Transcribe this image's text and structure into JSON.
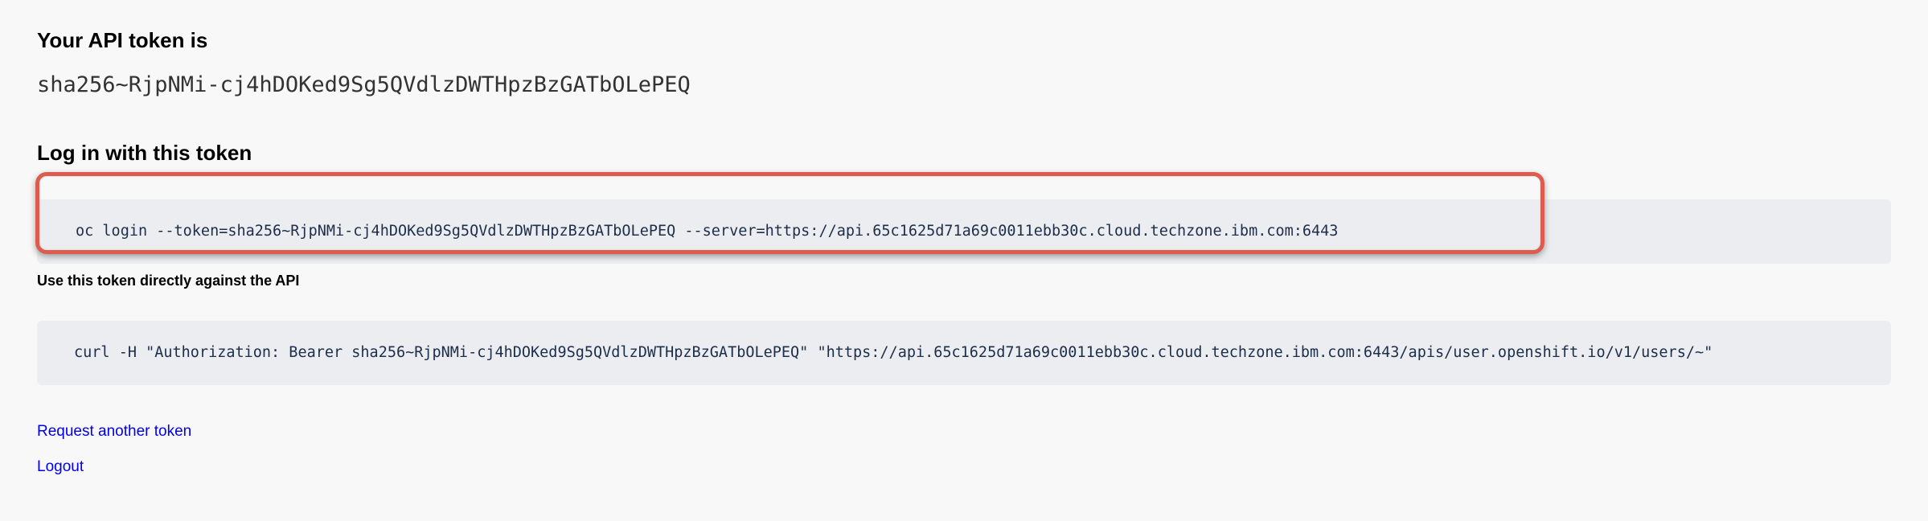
{
  "token_section": {
    "heading": "Your API token is",
    "token": "sha256~RjpNMi-cj4hDOKed9Sg5QVdlzDWTHpzBzGATbOLePEQ"
  },
  "login_section": {
    "heading": "Log in with this token",
    "command": "oc login --token=sha256~RjpNMi-cj4hDOKed9Sg5QVdlzDWTHpzBzGATbOLePEQ --server=https://api.65c1625d71a69c0011ebb30c.cloud.techzone.ibm.com:6443",
    "highlight_color": "#de5b4f"
  },
  "api_section": {
    "heading": "Use this token directly against the API",
    "command": "curl -H \"Authorization: Bearer sha256~RjpNMi-cj4hDOKed9Sg5QVdlzDWTHpzBzGATbOLePEQ\" \"https://api.65c1625d71a69c0011ebb30c.cloud.techzone.ibm.com:6443/apis/user.openshift.io/v1/users/~\""
  },
  "links": {
    "request_another": "Request another token",
    "logout": "Logout",
    "color": "#0000ee"
  }
}
